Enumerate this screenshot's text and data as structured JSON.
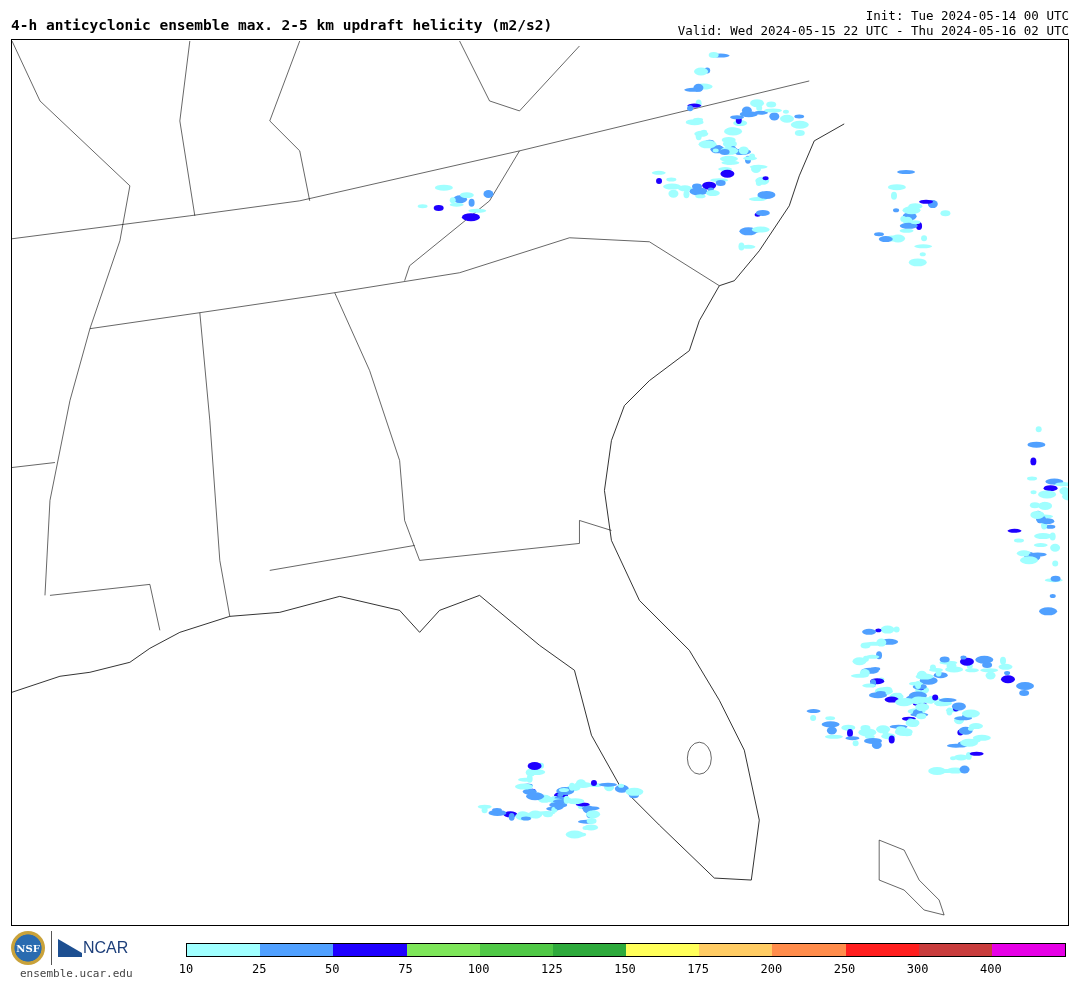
{
  "title": "4-h anticyclonic ensemble max. 2-5 km updraft helicity (m2/s2)",
  "init": "Init: Tue 2024-05-14 00 UTC",
  "valid": "Valid: Wed 2024-05-15 22 UTC - Thu 2024-05-16 02 UTC",
  "logos": {
    "nsf": "NSF",
    "ncar": "NCAR",
    "url": "ensemble.ucar.edu"
  },
  "colorbar": {
    "segments": [
      {
        "color": "#a0ffff"
      },
      {
        "color": "#50a0ff"
      },
      {
        "color": "#1e00ff"
      },
      {
        "color": "#7ee65a"
      },
      {
        "color": "#50c846"
      },
      {
        "color": "#2eaa3c"
      },
      {
        "color": "#ffff5a"
      },
      {
        "color": "#ffcc64"
      },
      {
        "color": "#ff8c4b"
      },
      {
        "color": "#ff1e1e"
      },
      {
        "color": "#c83c3c"
      },
      {
        "color": "#e600e6"
      }
    ],
    "ticks": [
      "10",
      "25",
      "50",
      "75",
      "100",
      "125",
      "150",
      "175",
      "200",
      "250",
      "300",
      "400"
    ]
  }
}
